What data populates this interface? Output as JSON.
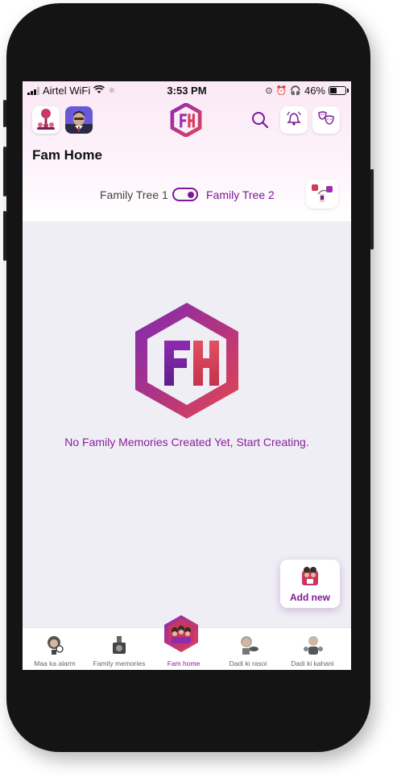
{
  "status_bar": {
    "carrier": "Airtel WiFi",
    "time": "3:53 PM",
    "battery": "46%"
  },
  "header": {
    "title": "Fam Home",
    "logo_icon": "fam-logo-icon",
    "search_icon": "search-icon",
    "bell_icon": "bell-icon",
    "masks_icon": "masks-icon"
  },
  "tree_switch": {
    "option_1": "Family Tree 1",
    "option_2": "Family Tree 2",
    "selected": "Family Tree 2"
  },
  "main": {
    "empty_message": "No Family Memories Created Yet, Start Creating."
  },
  "fab": {
    "label": "Add new"
  },
  "tabs": [
    {
      "label": "Maa ka alarm"
    },
    {
      "label": "Family memories"
    },
    {
      "label": "Fam home"
    },
    {
      "label": "Dadi ki rasoi"
    },
    {
      "label": "Dadi ki kahani"
    }
  ],
  "colors": {
    "accent": "#7b1a97",
    "logo_purple": "#8e2bb0",
    "logo_red": "#e04255"
  }
}
